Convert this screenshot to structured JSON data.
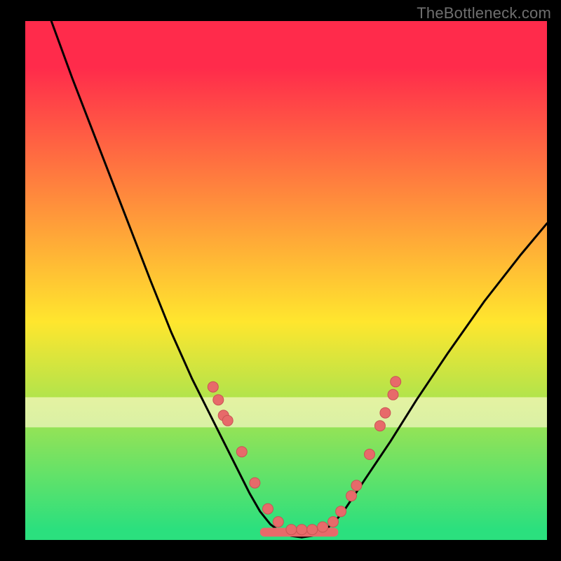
{
  "watermark": "TheBottleneck.com",
  "colors": {
    "frame": "#000000",
    "grad_top": "#ff2b4b",
    "grad_mid": "#ffe62e",
    "grad_bot": "#2be07e",
    "cream": "#fff9d0",
    "curve": "#000000",
    "dot_fill": "#e76a6a",
    "dot_stroke": "#c95454"
  },
  "chart_data": {
    "type": "line",
    "title": "",
    "xlabel": "",
    "ylabel": "",
    "xlim": [
      0,
      100
    ],
    "ylim": [
      0,
      100
    ],
    "curve": {
      "left": [
        [
          5,
          100
        ],
        [
          9,
          89
        ],
        [
          14,
          76
        ],
        [
          19,
          63
        ],
        [
          24,
          50
        ],
        [
          28,
          40
        ],
        [
          32,
          31
        ],
        [
          35,
          25
        ],
        [
          38,
          19
        ],
        [
          41,
          13
        ],
        [
          43,
          9
        ],
        [
          45,
          5.5
        ],
        [
          47,
          3
        ],
        [
          49,
          1.5
        ],
        [
          51,
          0.8
        ],
        [
          53,
          0.5
        ]
      ],
      "right": [
        [
          53,
          0.5
        ],
        [
          55,
          0.8
        ],
        [
          57,
          1.6
        ],
        [
          59,
          3.2
        ],
        [
          61,
          5.5
        ],
        [
          63,
          8.5
        ],
        [
          66,
          13
        ],
        [
          70,
          19
        ],
        [
          75,
          27
        ],
        [
          81,
          36
        ],
        [
          88,
          46
        ],
        [
          95,
          55
        ],
        [
          100,
          61
        ]
      ]
    },
    "flat_band": {
      "x0": 45,
      "x1": 60,
      "y": 1.5,
      "thickness": 1.7
    },
    "series": [
      {
        "name": "dots",
        "points": [
          [
            36.0,
            29.5
          ],
          [
            37.0,
            27.0
          ],
          [
            38.0,
            24.0
          ],
          [
            38.8,
            23.0
          ],
          [
            41.5,
            17.0
          ],
          [
            44.0,
            11.0
          ],
          [
            46.5,
            6.0
          ],
          [
            48.5,
            3.5
          ],
          [
            51.0,
            2.0
          ],
          [
            53.0,
            2.0
          ],
          [
            55.0,
            2.0
          ],
          [
            57.0,
            2.5
          ],
          [
            59.0,
            3.5
          ],
          [
            60.5,
            5.5
          ],
          [
            62.5,
            8.5
          ],
          [
            63.5,
            10.5
          ],
          [
            66.0,
            16.5
          ],
          [
            68.0,
            22.0
          ],
          [
            69.0,
            24.5
          ],
          [
            70.5,
            28.0
          ],
          [
            71.0,
            30.5
          ]
        ]
      }
    ]
  }
}
